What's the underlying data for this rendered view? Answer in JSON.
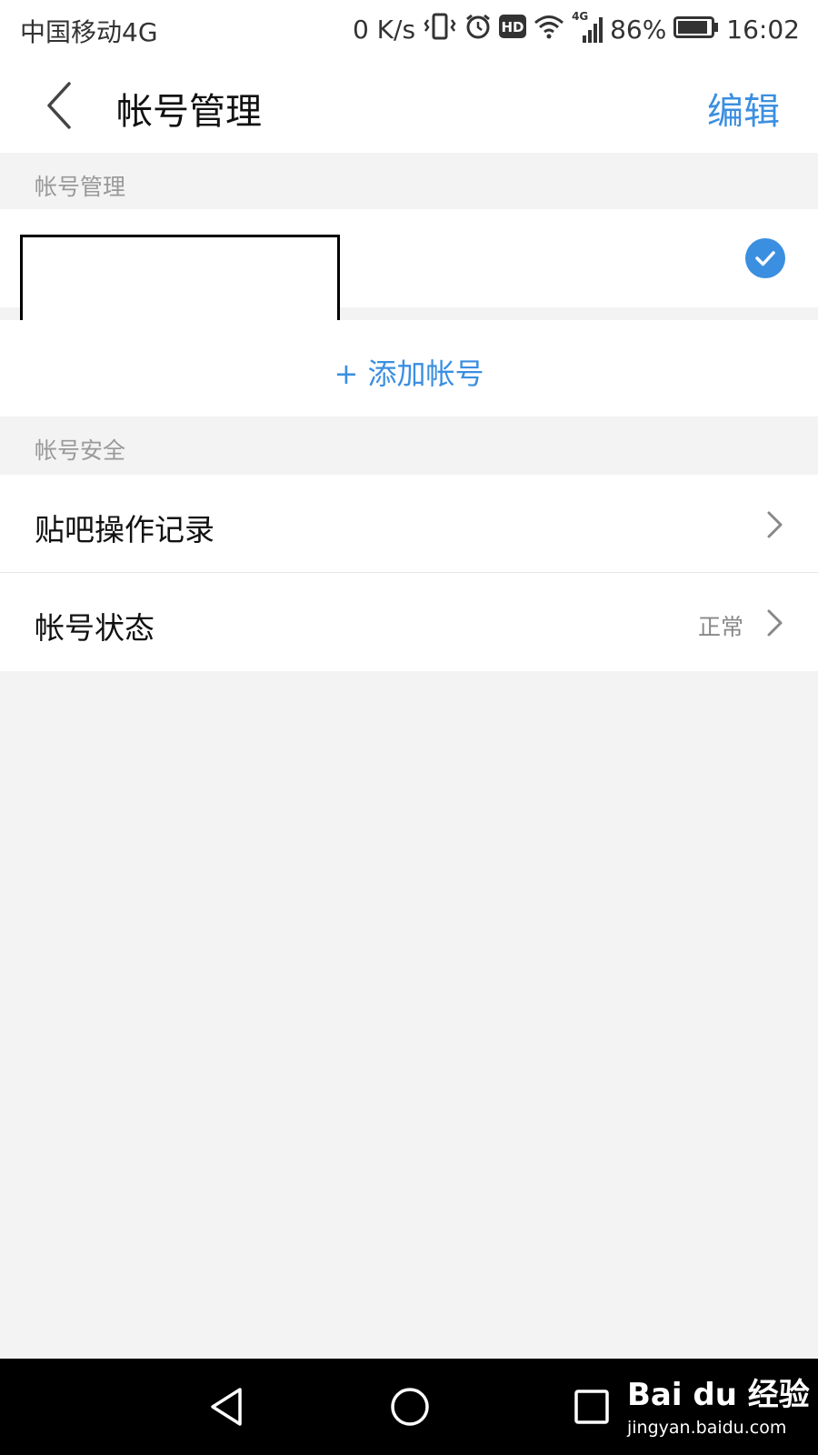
{
  "status_bar": {
    "carrier": "中国移动4G",
    "speed": "0 K/s",
    "hd": "HD",
    "network": "4G",
    "battery": "86%",
    "time": "16:02"
  },
  "header": {
    "title": "帐号管理",
    "edit_label": "编辑"
  },
  "account_section": {
    "label": "帐号管理",
    "add_account_label": "+ 添加帐号"
  },
  "security_section": {
    "label": "帐号安全",
    "items": [
      {
        "label": "贴吧操作记录",
        "value": ""
      },
      {
        "label": "帐号状态",
        "value": "正常"
      }
    ]
  },
  "watermark": {
    "brand": "Bai du 经验",
    "url": "jingyan.baidu.com"
  },
  "colors": {
    "accent": "#3b8fe0",
    "background": "#f3f3f3"
  }
}
